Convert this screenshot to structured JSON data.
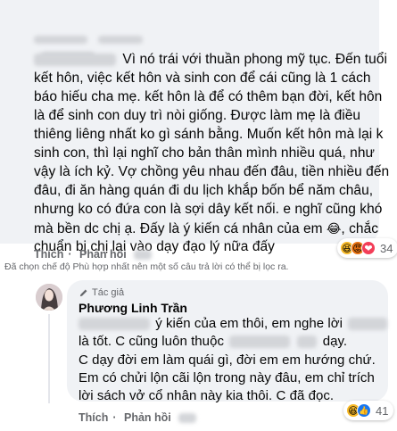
{
  "comment1": {
    "lines": [
      "Vì nó trái với thuần phong mỹ tục. Đến tuổi",
      "kết hôn, việc kết hôn và sinh con để cái cũng là 1 cách",
      "báo hiếu cha mẹ. kết hôn là để có thêm bạn đời, kết hôn",
      "là để sinh con duy trì nòi giống. Được làm mẹ là điều",
      "thiêng liêng nhất ko gì sánh bằng. Muốn kết hôn mà lại k",
      "sinh con, thì lại nghĩ cho bản thân mình nhiều quá, như",
      "vậy là ích kỷ. Vợ chồng yêu nhau đến đâu, tiền nhiều đến",
      "đâu, đi ăn hàng quán đi du lịch khắp bốn bể năm châu,",
      "nhưng ko có đứa con là sợi dây kết nối. e nghĩ cũng khó",
      "mà bền dc chị ạ. Đấy là ý kiến cá nhân của em",
      ", chắc",
      "chuẩn bị chị lại vào dạy đạo lý nữa đấy"
    ],
    "emoji_inline": "😂",
    "like_label": "Thích",
    "reply_label": "Phản hồi",
    "reaction_count": "34",
    "reaction_emojis": [
      "😆",
      "😡",
      "❤"
    ]
  },
  "notice_text": "Đã chọn chế độ Phù hợp nhất nên một số câu trả lời có thể bị lọc ra.",
  "comment2": {
    "author_badge": "Tác giả",
    "author_name": "Phương Linh Trần",
    "lines": [
      "ý kiến của em thôi, em nghe lời",
      "là tốt. C cũng luôn thuộc",
      "dạy.",
      "C dạy đời em làm quái gì, đời em em hướng chứ.",
      "Em có chửi lộn cãi lộn trong này đâu, em chỉ trích",
      "lời sách vở cổ nhân này kia thôi. C đã đọc."
    ],
    "like_label": "Thích",
    "reply_label": "Phản hồi",
    "reaction_count": "41",
    "reaction_emojis": [
      "😆",
      "👍"
    ]
  },
  "colors": {
    "bubble": "#f0f2f5",
    "meta": "#65676b",
    "text": "#050505",
    "haha": "#f7b928",
    "angry": "#e9710f",
    "love": "#f33e58",
    "like": "#1877f2"
  }
}
